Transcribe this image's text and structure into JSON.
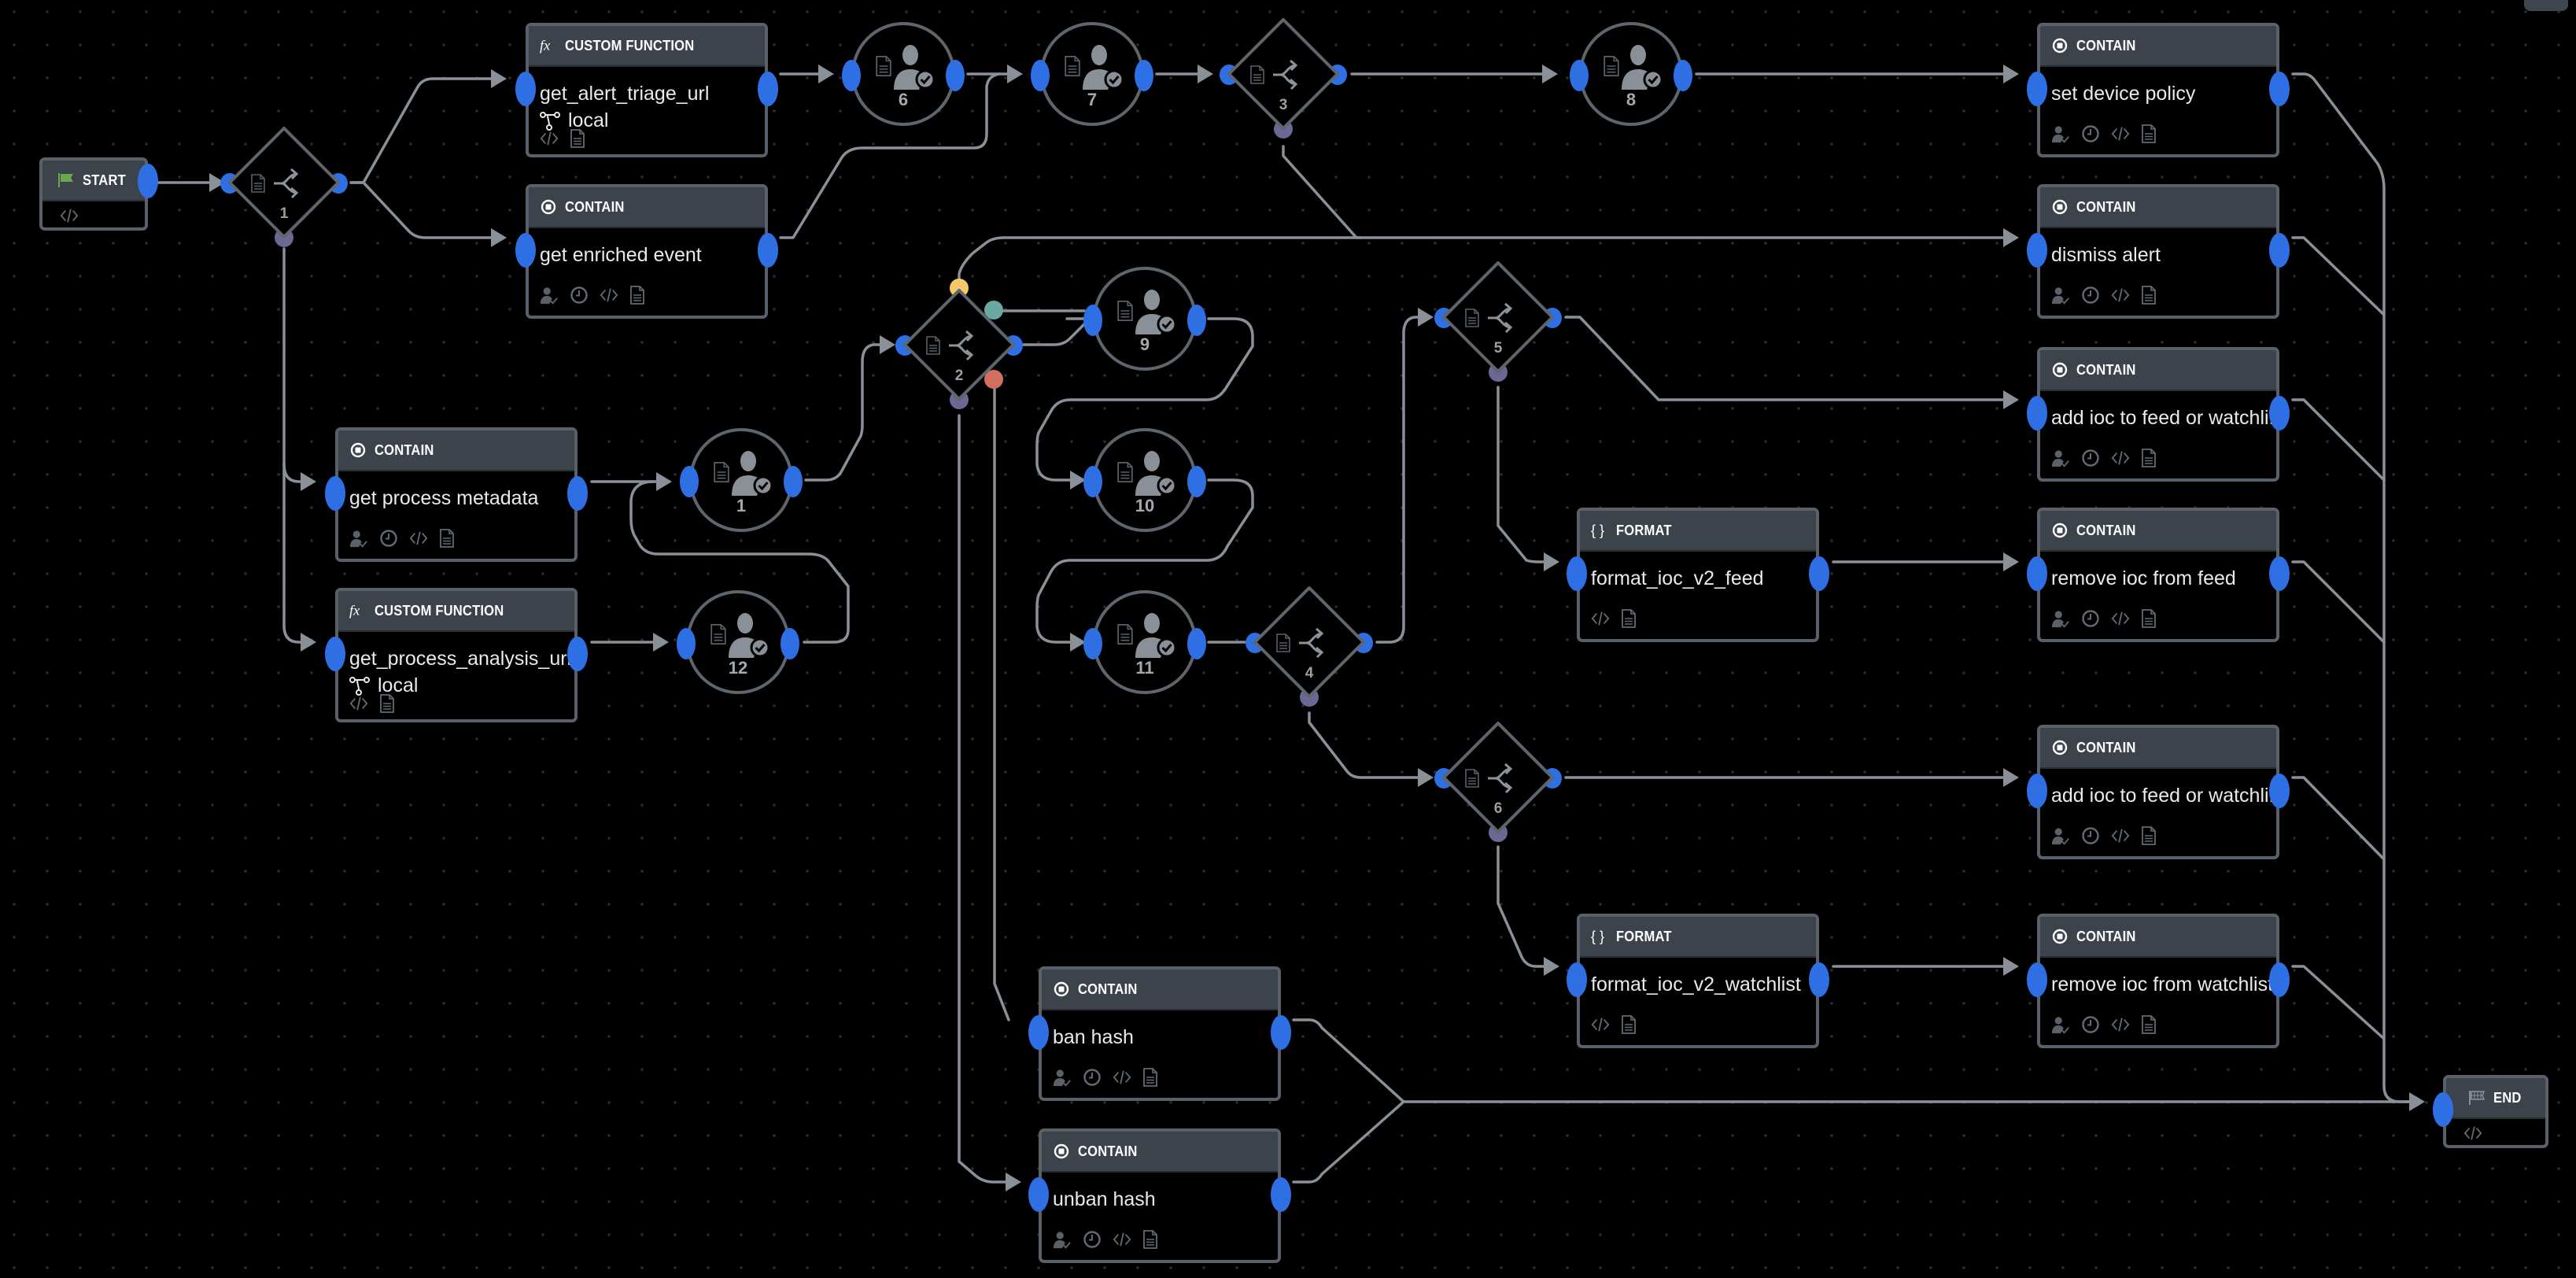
{
  "colors": {
    "background": "#000000",
    "port_blue": "#2f6fe4",
    "port_purple": "#6b6894",
    "port_yellow": "#f3c969",
    "port_teal": "#6aa9a3",
    "port_red": "#d2705f",
    "start_flag": "#6aa84f",
    "edge": "#8a9097",
    "header": "#3d434b"
  },
  "start": {
    "label": "START",
    "icon": "flag-icon",
    "footer_icon": "code-icon"
  },
  "end": {
    "label": "END",
    "icon": "checkered-flag-icon",
    "footer_icon": "code-icon"
  },
  "block_types": {
    "custom_function": {
      "label": "CUSTOM FUNCTION",
      "icon": "fx-icon"
    },
    "contain": {
      "label": "CONTAIN",
      "icon": "stop-circle-icon"
    },
    "format": {
      "label": "FORMAT",
      "icon": "braces-icon"
    }
  },
  "blocks": [
    {
      "id": "get_alert_triage_url",
      "type": "custom_function",
      "title": "get_alert_triage_url",
      "sub": "local",
      "sub_icon": "branch-icon",
      "footer": [
        "code-icon",
        "document-icon"
      ]
    },
    {
      "id": "get_enriched_event",
      "type": "contain",
      "title": "get enriched event",
      "footer": [
        "user-check-icon",
        "clock-icon",
        "code-icon",
        "document-icon"
      ]
    },
    {
      "id": "get_process_metadata",
      "type": "contain",
      "title": "get process metadata",
      "footer": [
        "user-check-icon",
        "clock-icon",
        "code-icon",
        "document-icon"
      ]
    },
    {
      "id": "get_process_analysis_url",
      "type": "custom_function",
      "title": "get_process_analysis_url",
      "sub": "local",
      "sub_icon": "branch-icon",
      "footer": [
        "code-icon",
        "document-icon"
      ]
    },
    {
      "id": "set_device_policy",
      "type": "contain",
      "title": "set device policy",
      "footer": [
        "user-check-icon",
        "clock-icon",
        "code-icon",
        "document-icon"
      ]
    },
    {
      "id": "dismiss_alert",
      "type": "contain",
      "title": "dismiss alert",
      "footer": [
        "user-check-icon",
        "clock-icon",
        "code-icon",
        "document-icon"
      ]
    },
    {
      "id": "add_ioc_1",
      "type": "contain",
      "title": "add ioc to feed or watchli...",
      "footer": [
        "user-check-icon",
        "clock-icon",
        "code-icon",
        "document-icon"
      ]
    },
    {
      "id": "format_ioc_v2_feed",
      "type": "format",
      "title": "format_ioc_v2_feed",
      "footer": [
        "code-icon",
        "document-icon"
      ]
    },
    {
      "id": "remove_ioc_from_feed",
      "type": "contain",
      "title": "remove ioc from feed",
      "footer": [
        "user-check-icon",
        "clock-icon",
        "code-icon",
        "document-icon"
      ]
    },
    {
      "id": "add_ioc_2",
      "type": "contain",
      "title": "add ioc to feed or watchli...",
      "footer": [
        "user-check-icon",
        "clock-icon",
        "code-icon",
        "document-icon"
      ]
    },
    {
      "id": "format_ioc_v2_watchlist",
      "type": "format",
      "title": "format_ioc_v2_watchlist",
      "footer": [
        "code-icon",
        "document-icon"
      ]
    },
    {
      "id": "remove_ioc_from_watchlist",
      "type": "contain",
      "title": "remove ioc from watchlist",
      "footer": [
        "user-check-icon",
        "clock-icon",
        "code-icon",
        "document-icon"
      ]
    },
    {
      "id": "ban_hash",
      "type": "contain",
      "title": "ban hash",
      "footer": [
        "user-check-icon",
        "clock-icon",
        "code-icon",
        "document-icon"
      ]
    },
    {
      "id": "unban_hash",
      "type": "contain",
      "title": "unban hash",
      "footer": [
        "user-check-icon",
        "clock-icon",
        "code-icon",
        "document-icon"
      ]
    }
  ],
  "prompts": [
    {
      "id": "p6",
      "number": "6"
    },
    {
      "id": "p7",
      "number": "7"
    },
    {
      "id": "p8",
      "number": "8"
    },
    {
      "id": "p9",
      "number": "9"
    },
    {
      "id": "p10",
      "number": "10"
    },
    {
      "id": "p11",
      "number": "11"
    },
    {
      "id": "p1",
      "number": "1"
    },
    {
      "id": "p12",
      "number": "12"
    }
  ],
  "decisions": [
    {
      "id": "d1",
      "number": "1",
      "ports": [
        "purple"
      ]
    },
    {
      "id": "d2",
      "number": "2",
      "ports": [
        "yellow",
        "teal",
        "red",
        "purple"
      ]
    },
    {
      "id": "d3",
      "number": "3",
      "ports": [
        "purple"
      ]
    },
    {
      "id": "d4",
      "number": "4",
      "ports": [
        "purple"
      ]
    },
    {
      "id": "d5",
      "number": "5",
      "ports": [
        "purple"
      ]
    },
    {
      "id": "d6",
      "number": "6",
      "ports": [
        "purple"
      ]
    }
  ]
}
